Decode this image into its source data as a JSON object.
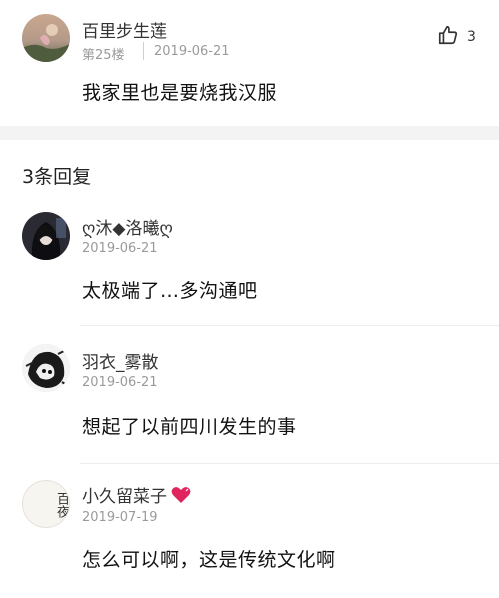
{
  "main_comment": {
    "author": "百里步生莲",
    "floor": "第25楼",
    "date": "2019-06-21",
    "like_count": "3",
    "text": "我家里也是要烧我汉服"
  },
  "replies_header": "3条回复",
  "replies": [
    {
      "author": "ღ沐◆洛曦ღ",
      "date": "2019-06-21",
      "text": "太极端了…多沟通吧"
    },
    {
      "author": "羽衣_雾散",
      "date": "2019-06-21",
      "text": "想起了以前四川发生的事"
    },
    {
      "author": "小久留菜子",
      "date": "2019-07-19",
      "text": "怎么可以啊，这是传统文化啊"
    }
  ],
  "avatar3_text": "百夜",
  "icons": {
    "like": "thumbs-up-icon",
    "heart": "heart-emoji-icon"
  },
  "colors": {
    "heart": "#e0245e"
  }
}
